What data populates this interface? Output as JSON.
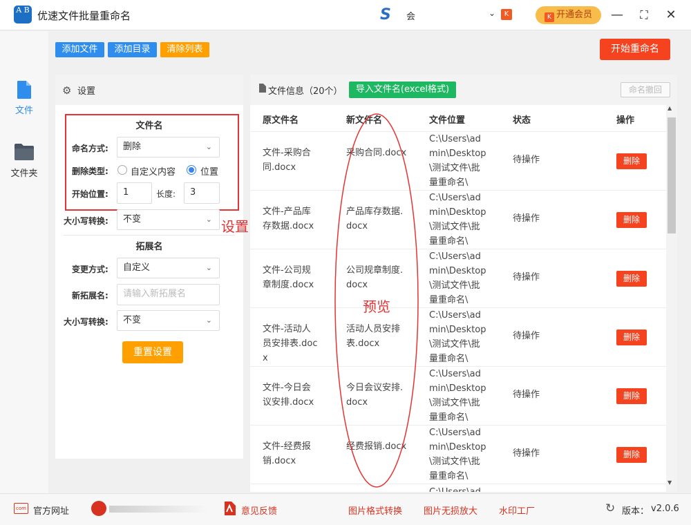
{
  "app": {
    "title": "优速文件批量重命名",
    "logo_text": "A B"
  },
  "user": {
    "name": "会",
    "vip_label": "开通会员",
    "vip_badge": "K"
  },
  "window": {
    "minimize": "—",
    "maximize": "⛶",
    "close": "✕"
  },
  "nav": [
    {
      "label": "文件",
      "active": true
    },
    {
      "label": "文件夹",
      "active": false
    }
  ],
  "toolbar": {
    "add_file": "添加文件",
    "add_dir": "添加目录",
    "clear_list": "清除列表",
    "start_rename": "开始重命名"
  },
  "settings": {
    "title": "设置",
    "filename_section": "文件名",
    "naming_mode_label": "命名方式:",
    "naming_mode_value": "删除",
    "delete_type_label": "删除类型:",
    "delete_opt_custom": "自定义内容",
    "delete_opt_position": "位置",
    "start_pos_label": "开始位置:",
    "start_pos_value": "1",
    "length_label": "长度:",
    "length_value": "3",
    "case_label": "大小写转换:",
    "case_value": "不变",
    "ext_section": "拓展名",
    "change_mode_label": "变更方式:",
    "change_mode_value": "自定义",
    "new_ext_label": "新拓展名:",
    "new_ext_placeholder": "请输入新拓展名",
    "ext_case_label": "大小写转换:",
    "ext_case_value": "不变",
    "reset_label": "重置设置"
  },
  "annotations": {
    "settings": "设置",
    "preview": "预览"
  },
  "files": {
    "header_label": "文件信息（20个）",
    "import_label": "导入文件名(excel格式)",
    "undo_label": "命名撤回",
    "columns": [
      "原文件名",
      "新文件名",
      "文件位置",
      "状态",
      "操作"
    ],
    "rows": [
      {
        "orig": "文件-采购合同.docx",
        "new": "采购合同.docx",
        "loc": "C:\\Users\\admin\\Desktop\\测试文件\\批量重命名\\",
        "status": "待操作",
        "action": "删除"
      },
      {
        "orig": "文件-产品库存数据.docx",
        "new": "产品库存数据.docx",
        "loc": "C:\\Users\\admin\\Desktop\\测试文件\\批量重命名\\",
        "status": "待操作",
        "action": "删除"
      },
      {
        "orig": "文件-公司规章制度.docx",
        "new": "公司规章制度.docx",
        "loc": "C:\\Users\\admin\\Desktop\\测试文件\\批量重命名\\",
        "status": "待操作",
        "action": "删除"
      },
      {
        "orig": "文件-活动人员安排表.docx",
        "new": "活动人员安排表.docx",
        "loc": "C:\\Users\\admin\\Desktop\\测试文件\\批量重命名\\",
        "status": "待操作",
        "action": "删除"
      },
      {
        "orig": "文件-今日会议安排.docx",
        "new": "今日会议安排.docx",
        "loc": "C:\\Users\\admin\\Desktop\\测试文件\\批量重命名\\",
        "status": "待操作",
        "action": "删除"
      },
      {
        "orig": "文件-经费报销.docx",
        "new": "经费报销.docx",
        "loc": "C:\\Users\\admin\\Desktop\\测试文件\\批量重命名\\",
        "status": "待操作",
        "action": "删除"
      }
    ],
    "partial_row_text": "C:\\Users\\ad"
  },
  "footer": {
    "website": "官方网址",
    "feedback": "意见反馈",
    "img_convert": "图片格式转换",
    "img_enlarge": "图片无损放大",
    "watermark": "水印工厂",
    "version_label": "版本：",
    "version_value": "v2.0.6"
  },
  "colors": {
    "primary_blue": "#2e8ded",
    "orange": "#ff9f00",
    "red": "#f5421f",
    "green": "#1fb862",
    "annotation_red": "#e53333"
  }
}
